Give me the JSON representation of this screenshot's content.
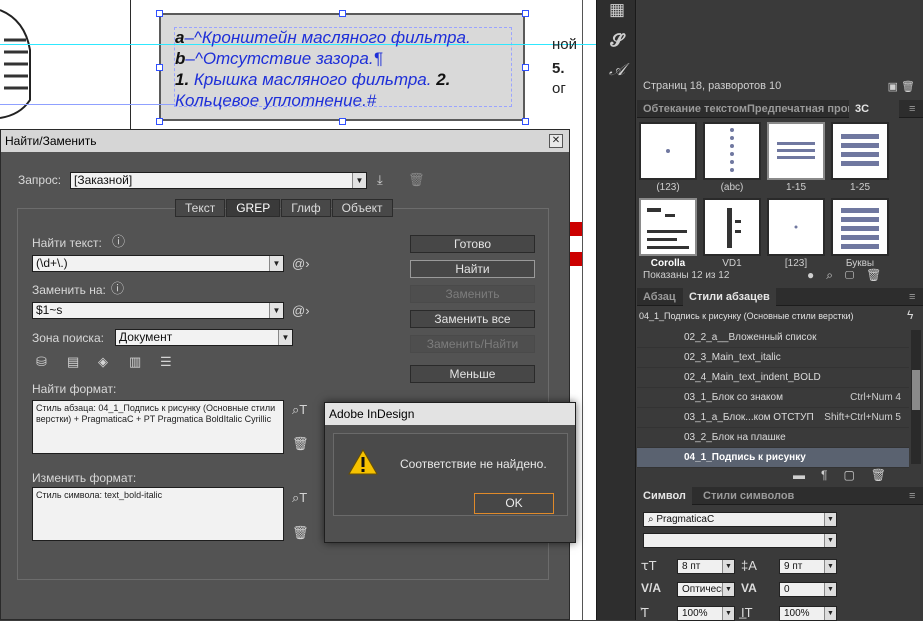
{
  "document": {
    "frame_lines": [
      {
        "prefix": "а",
        "text": "–^Кронштейн масляного фильтра."
      },
      {
        "prefix": "b",
        "text": "–^Отсутствие зазора.¶"
      },
      {
        "prefix": "1.",
        "text": " Крышка масляного фильтра. ",
        "suffix": "2."
      },
      {
        "prefix": "",
        "text": "Кольцевое уплотнение.#"
      }
    ],
    "side_text_1": "ной",
    "side_text_2": "5.",
    "side_text_3": "ог"
  },
  "pages_panel": {
    "status": "Страниц 18, разворотов 10"
  },
  "glyphs_panel": {
    "tabs": [
      "Обтекание текстом",
      "Предпечатная прове",
      "3С"
    ],
    "thumbs": [
      {
        "label": "(123)"
      },
      {
        "label": "(abc)"
      },
      {
        "label": "1-15"
      },
      {
        "label": "1-25"
      },
      {
        "label": "Corolla"
      },
      {
        "label": "VD1"
      },
      {
        "label": "[123]"
      },
      {
        "label": "Буквы"
      }
    ],
    "status": "Показаны 12 из 12"
  },
  "para_styles_panel": {
    "tabs": [
      "Абзац",
      "Стили абзацев"
    ],
    "current": "04_1_Подпись к рисунку (Основные стили верстки)",
    "items": [
      {
        "name": "02_2_а__Вложенный список",
        "key": ""
      },
      {
        "name": "02_3_Main_text_italic",
        "key": ""
      },
      {
        "name": "02_4_Main_text_indent_BOLD",
        "key": ""
      },
      {
        "name": "03_1_Блок со знаком",
        "key": "Ctrl+Num 4"
      },
      {
        "name": "03_1_а_Блок...ком ОТСТУП",
        "key": "Shift+Ctrl+Num 5"
      },
      {
        "name": "03_2_Блок на плашке",
        "key": ""
      },
      {
        "name": "04_1_Подпись к рисунку",
        "key": ""
      }
    ]
  },
  "char_panel": {
    "tabs": [
      "Символ",
      "Стили символов"
    ],
    "font": "PragmaticaC",
    "style": "",
    "size": "8 пт",
    "leading": "9 пт",
    "kerning": "Оптическ",
    "tracking": "0",
    "vscale": "100%",
    "hscale": "100%"
  },
  "find_dialog": {
    "title": "Найти/Заменить",
    "query_label": "Запрос:",
    "query_value": "[Заказной]",
    "tabs": [
      "Текст",
      "GREP",
      "Глиф",
      "Объект"
    ],
    "find_label": "Найти текст:",
    "find_value": "(\\d+\\.)",
    "replace_label": "Заменить на:",
    "replace_value": "$1~s",
    "search_label": "Зона поиска:",
    "search_value": "Документ",
    "find_format_label": "Найти формат:",
    "find_format_value": "Стиль абзаца: 04_1_Подпись к рисунку (Основные стили верстки) + PragmaticaC + PT Pragmatica BoldItalic Cyrillic",
    "change_format_label": "Изменить формат:",
    "change_format_value": "Стиль символа: text_bold-italic",
    "buttons": {
      "done": "Готово",
      "find": "Найти",
      "change": "Заменить",
      "change_all": "Заменить все",
      "change_find": "Заменить/Найти",
      "less": "Меньше"
    }
  },
  "alert": {
    "title": "Adobe InDesign",
    "message": "Соответствие не найдено.",
    "ok": "OK"
  }
}
